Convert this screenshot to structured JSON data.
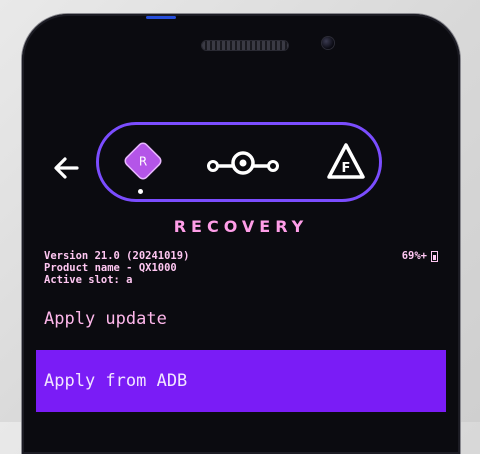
{
  "header": {
    "title": "RECOVERY"
  },
  "nav": {
    "recovery_letter": "R",
    "fastboot_letter": "F"
  },
  "info": {
    "version": "Version 21.0 (20241019)",
    "product": "Product name - QX1000",
    "slot": "Active slot: a",
    "battery": "69%+"
  },
  "menu": {
    "items": [
      {
        "label": "Apply update"
      },
      {
        "label": "Apply from ADB",
        "selected": true
      }
    ]
  },
  "colors": {
    "accent": "#7b4dff",
    "selection": "#7a1cf6",
    "text": "#ffb8ec",
    "background": "#0b0b10"
  }
}
